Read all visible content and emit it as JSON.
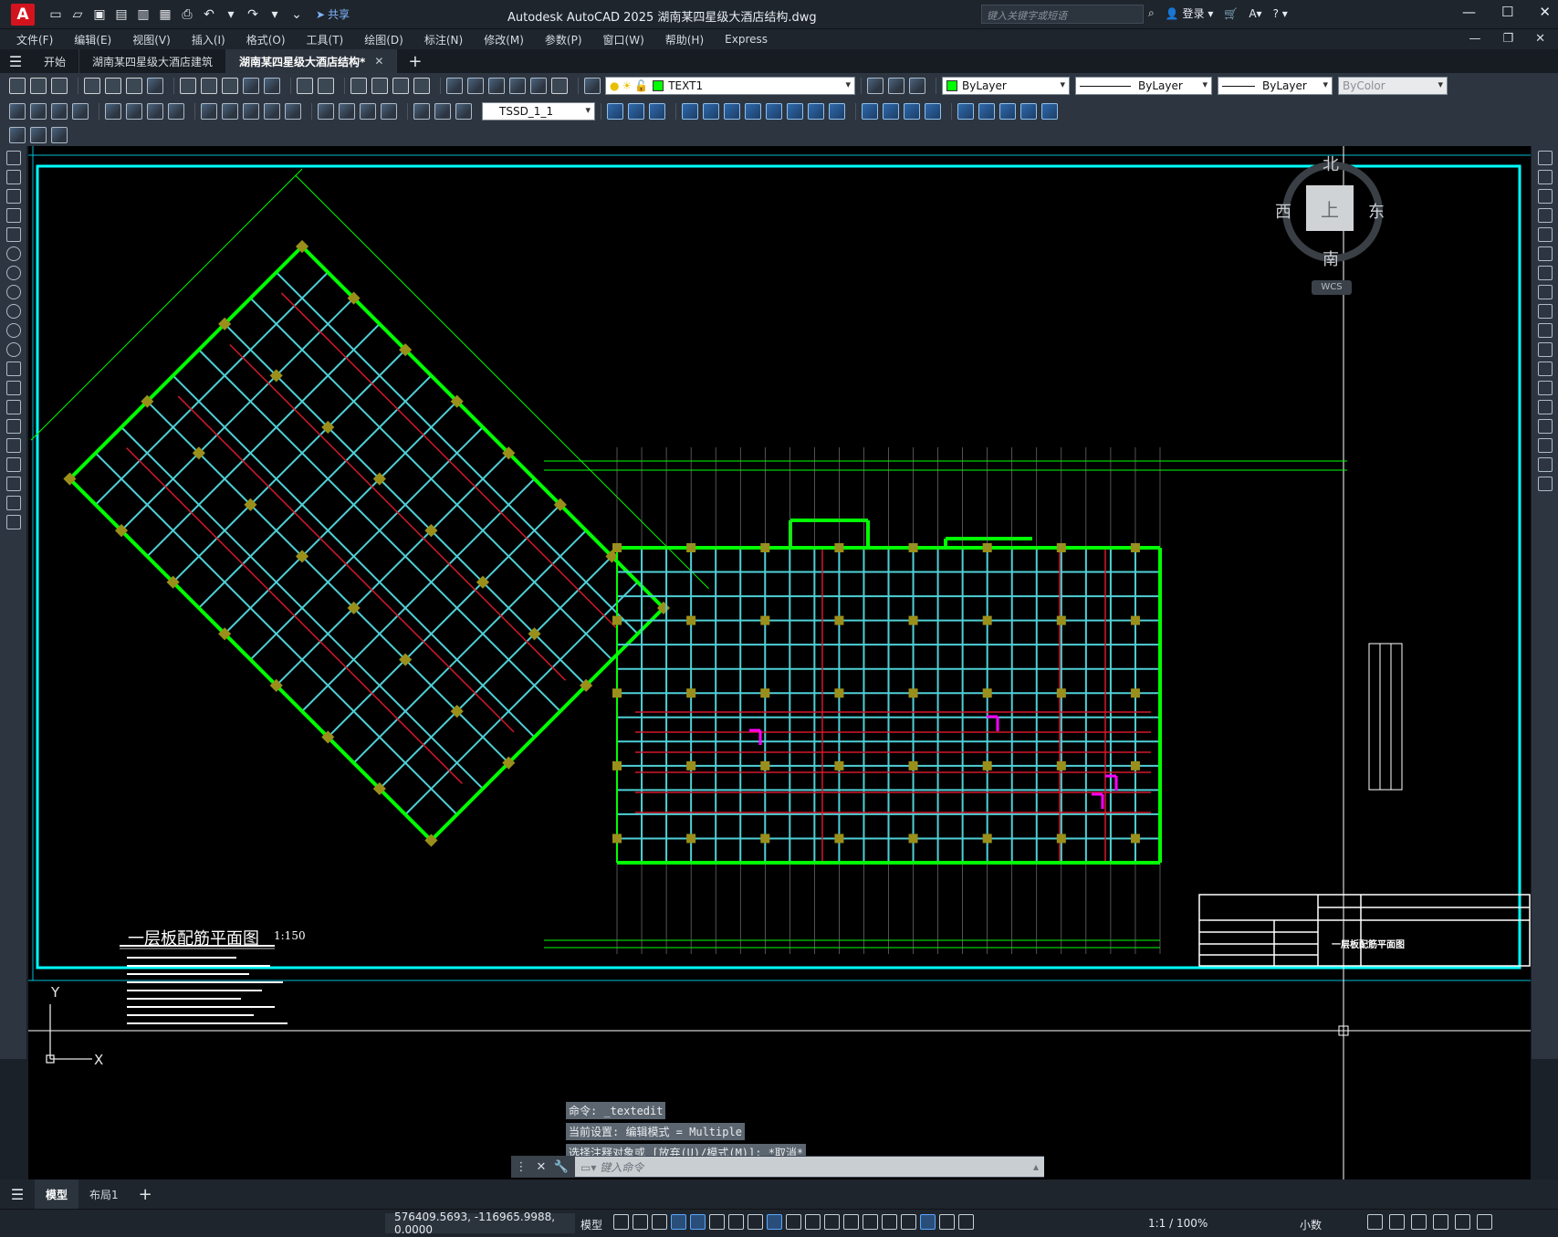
{
  "app": {
    "logo": "A",
    "title": "Autodesk AutoCAD 2025    湖南某四星级大酒店结构.dwg",
    "share_label": "共享",
    "search_placeholder": "键入关键字或短语",
    "login_label": "登录",
    "help_icon": "?"
  },
  "menu": [
    "文件(F)",
    "编辑(E)",
    "视图(V)",
    "插入(I)",
    "格式(O)",
    "工具(T)",
    "绘图(D)",
    "标注(N)",
    "修改(M)",
    "参数(P)",
    "窗口(W)",
    "帮助(H)",
    "Express"
  ],
  "file_tabs": [
    {
      "label": "开始",
      "active": false,
      "closable": false
    },
    {
      "label": "湖南某四星级大酒店建筑",
      "active": false,
      "closable": false
    },
    {
      "label": "湖南某四星级大酒店结构*",
      "active": true,
      "closable": true
    }
  ],
  "toolbar": {
    "layer_name": "TEXT1",
    "color": "ByLayer",
    "linetype": "ByLayer",
    "lineweight": "ByLayer",
    "plotstyle": "ByColor",
    "dimstyle": "TSSD_1_1"
  },
  "viewcube": {
    "north": "北",
    "south": "南",
    "east": "东",
    "west": "西",
    "face": "上",
    "wcs": "WCS"
  },
  "drawing": {
    "title": "一层板配筋平面图",
    "scale": "1:150",
    "title_block_name": "一层板配筋平面图"
  },
  "command": {
    "history": [
      "命令: _textedit",
      "当前设置: 编辑模式 = Multiple",
      "选择注释对象或 [放弃(U)/模式(M)]: *取消*"
    ],
    "placeholder": "键入命令"
  },
  "layout_tabs": [
    {
      "label": "模型",
      "active": true
    },
    {
      "label": "布局1",
      "active": false
    }
  ],
  "status": {
    "coordinates": "576409.5693, -116965.9988, 0.0000",
    "mode": "模型",
    "annotation_scale": "1:1 / 100%",
    "units": "小数"
  },
  "colors": {
    "canvas_bg": "#000000",
    "beam_cyan": "#4fd0d6",
    "wall_green": "#00ff00",
    "rebar_red": "#d2192a",
    "magenta": "#ff00ff",
    "column_olive": "#9a8f1a",
    "frame_cyan": "#00ffff"
  }
}
